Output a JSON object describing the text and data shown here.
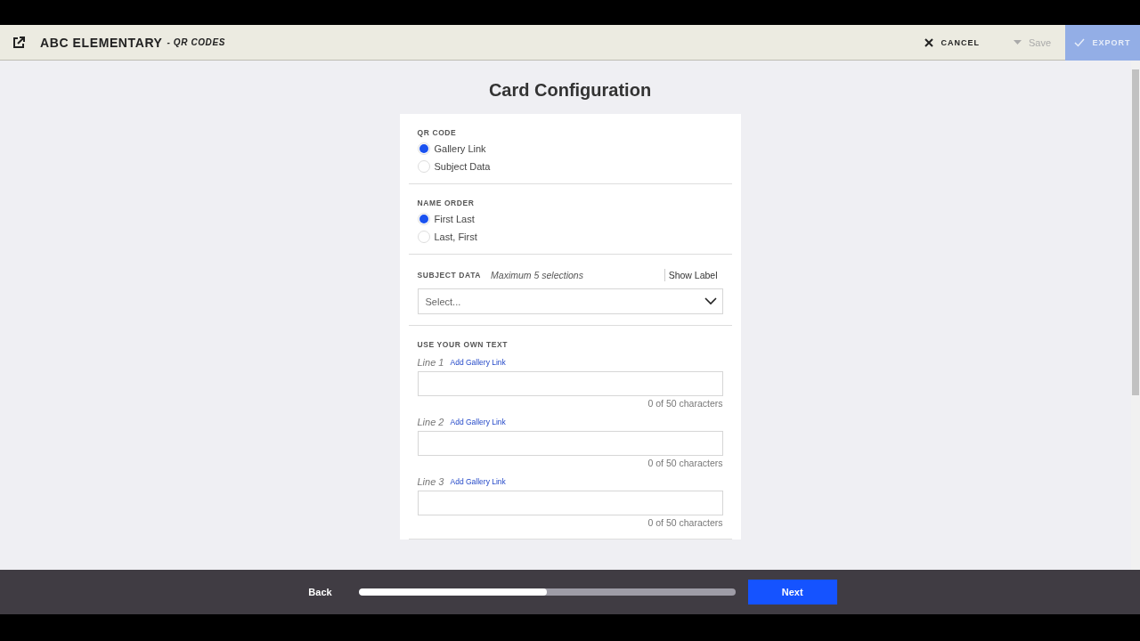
{
  "header": {
    "title": "ABC ELEMENTARY",
    "subtitle": "- QR CODES",
    "cancel": {
      "label": "CANCEL"
    },
    "save": {
      "label": "Save",
      "disabled": true
    },
    "export": {
      "label": "EXPORT",
      "disabled": true
    }
  },
  "page_title": "Card Configuration",
  "sections": [
    {
      "kind": "radio",
      "label": "QR CODE",
      "options": [
        {
          "label": "Gallery Link",
          "selected": true
        },
        {
          "label": "Subject Data",
          "selected": false
        }
      ]
    },
    {
      "kind": "radio",
      "label": "NAME ORDER",
      "options": [
        {
          "label": "First Last",
          "selected": true
        },
        {
          "label": "Last, First",
          "selected": false
        }
      ]
    },
    {
      "kind": "select",
      "label": "SUBJECT DATA",
      "hint": "Maximum 5 selections",
      "toggle": "Show Label",
      "placeholder": "Select..."
    },
    {
      "kind": "lines",
      "label": "USE YOUR OWN TEXT",
      "lines": [
        {
          "label": "Line 1",
          "link": "Add Gallery Link",
          "counter": "0 of 50 characters"
        },
        {
          "label": "Line 2",
          "link": "Add Gallery Link",
          "counter": "0 of 50 characters"
        },
        {
          "label": "Line 3",
          "link": "Add Gallery Link",
          "counter": "0 of 50 characters"
        }
      ]
    }
  ],
  "footer": {
    "back": "Back",
    "progress": {
      "level": 0.5
    },
    "next": "Next"
  }
}
